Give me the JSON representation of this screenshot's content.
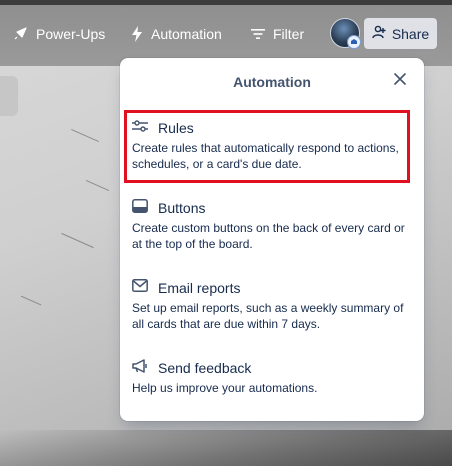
{
  "header": {
    "power_ups_label": "Power-Ups",
    "automation_label": "Automation",
    "filter_label": "Filter",
    "share_label": "Share"
  },
  "popover": {
    "title": "Automation",
    "items": [
      {
        "label": "Rules",
        "description": "Create rules that automatically respond to actions, schedules, or a card's due date.",
        "icon": "sliders-icon"
      },
      {
        "label": "Buttons",
        "description": "Create custom buttons on the back of every card or at the top of the board.",
        "icon": "card-button-icon"
      },
      {
        "label": "Email reports",
        "description": "Set up email reports, such as a weekly summary of all cards that are due within 7 days.",
        "icon": "envelope-icon"
      },
      {
        "label": "Send feedback",
        "description": "Help us improve your automations.",
        "icon": "megaphone-icon"
      }
    ]
  },
  "colors": {
    "highlight": "#e01020",
    "popover_bg": "#ffffff",
    "text": "#172b4d",
    "share_bg": "#dfe1e6"
  }
}
